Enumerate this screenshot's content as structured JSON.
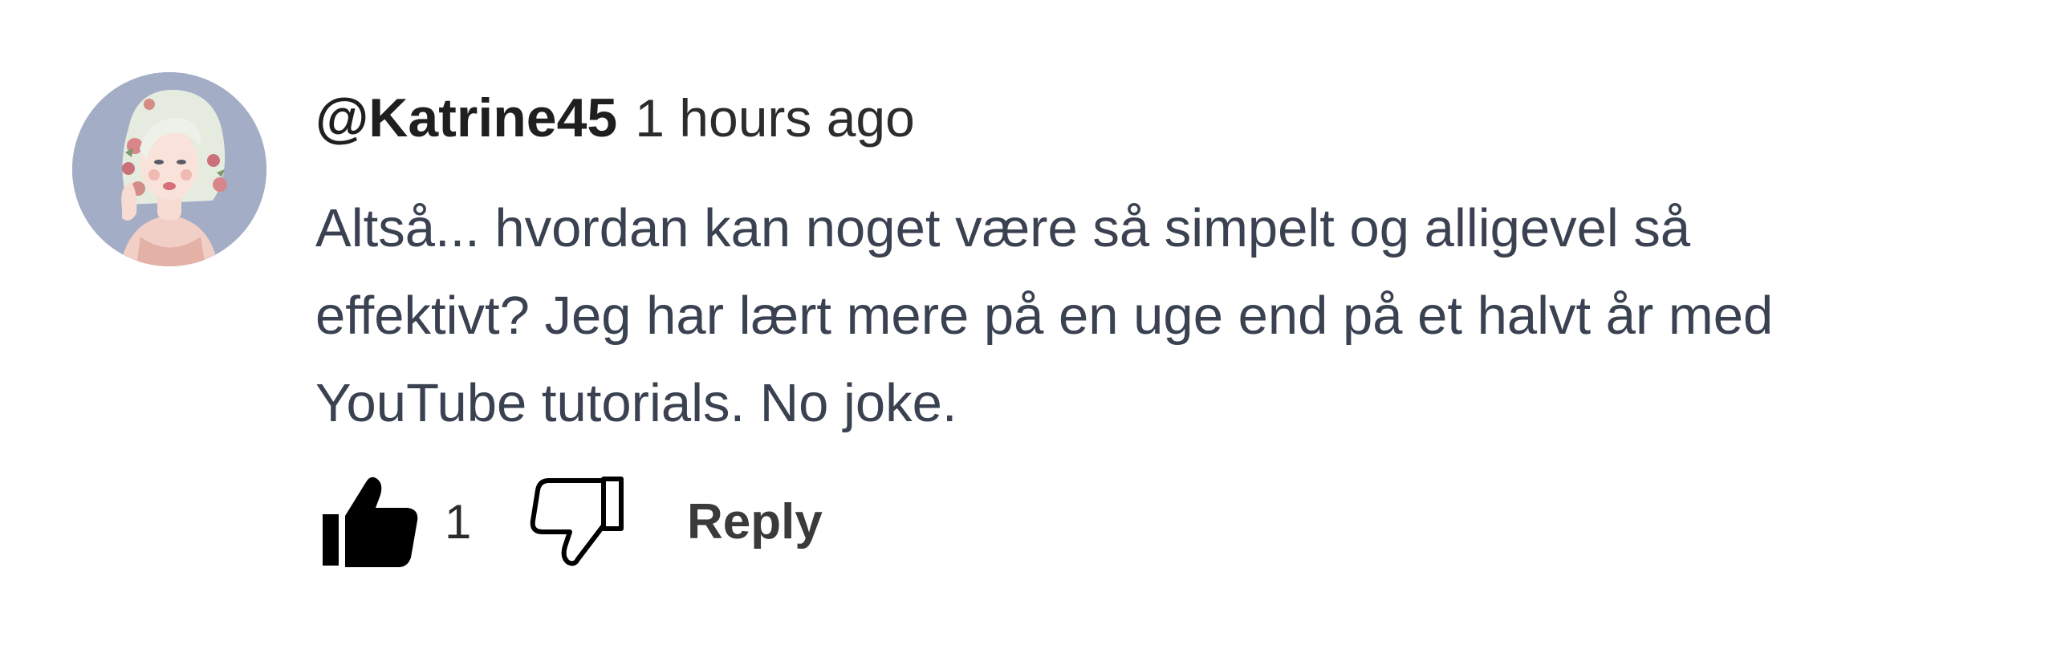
{
  "comment": {
    "author": "@Katrine45",
    "timestamp": "1 hours ago",
    "body_lines": [
      "Altså... hvordan kan noget være så simpelt og alligevel så",
      "effektivt? Jeg har lært mere på en uge end på et halvt år med",
      "YouTube tutorials. No joke."
    ],
    "like_count": "1",
    "reply_label": "Reply",
    "avatar": "illustrated-woman-avatar",
    "icons": {
      "like": "thumbs-up-filled-icon",
      "dislike": "thumbs-down-outline-icon"
    },
    "colors": {
      "author": "#1f1f1f",
      "body_text": "#3a4150",
      "avatar_bg": "#a3adc6"
    }
  }
}
